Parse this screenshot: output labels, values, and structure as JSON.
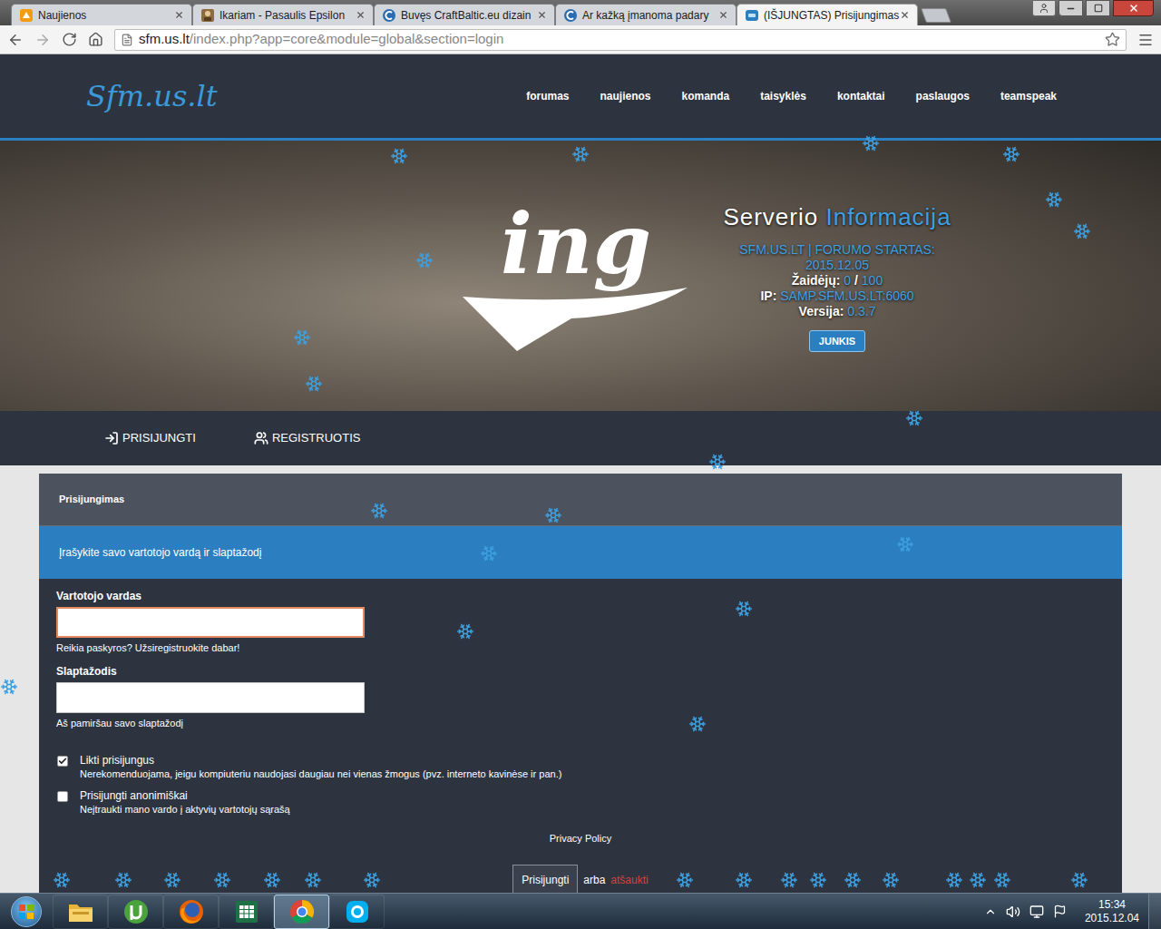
{
  "browser": {
    "tabs": [
      {
        "label": "Naujienos",
        "selected": false,
        "kind": "orange"
      },
      {
        "label": "Ikariam - Pasaulis Epsilon",
        "selected": false,
        "kind": "ikariam"
      },
      {
        "label": "Buvęs CraftBaltic.eu dizain",
        "selected": false,
        "kind": "craftbaltic"
      },
      {
        "label": "Ar kažką įmanoma padary",
        "selected": false,
        "kind": "craftbaltic"
      },
      {
        "label": "(IŠJUNGTAS) Prisijungimas",
        "selected": true,
        "kind": "sfm"
      }
    ],
    "url_host": "sfm.us.lt",
    "url_path": "/index.php?app=core&module=global&section=login"
  },
  "site": {
    "logo": "Sfm.us.lt",
    "nav": [
      "forumas",
      "naujienos",
      "komanda",
      "taisyklės",
      "kontaktai",
      "paslaugos",
      "teamspeak"
    ]
  },
  "banner": {
    "logo": "ing",
    "title_a": "Serverio",
    "title_b": "Informacija",
    "start_label": "SFM.US.LT | FORUMO STARTAS:",
    "start_date": "2015.12.05",
    "players_label": "Žaidėjų:",
    "players": "0",
    "players_sep": "/",
    "players_max": "100",
    "ip_label": "IP:",
    "ip": "SAMP.SFM.US.LT:6060",
    "version_label": "Versija:",
    "version": "0.3.7",
    "join": "JUNKIS"
  },
  "subnav": [
    {
      "label": "PRISIJUNGTI",
      "kind": "login"
    },
    {
      "label": "REGISTRUOTIS",
      "kind": "register"
    }
  ],
  "login": {
    "title": "Prisijungimas",
    "instruction": "Įrašykite savo vartotojo vardą ir slaptažodį",
    "fields": [
      {
        "label": "Vartotojo vardas",
        "value": "",
        "focused": true,
        "help": "Reikia paskyros? Užsiregistruokite dabar!"
      },
      {
        "label": "Slaptažodis",
        "value": "",
        "focused": false,
        "help": "Aš pamiršau savo slaptažodį"
      }
    ],
    "options": [
      {
        "label": "Likti prisijungus",
        "description": "Nerekomenduojama, jeigu kompiuteriu naudojasi daugiau nei vienas žmogus (pvz. interneto kavinėse ir pan.)",
        "checked": true
      },
      {
        "label": "Prisijungti anonimiškai",
        "description": "Neįtraukti mano vardo į aktyvių vartotojų sąrašą",
        "checked": false
      }
    ],
    "privacy": "Privacy Policy",
    "submit": "Prisijungti",
    "or": "arba",
    "cancel": "atšaukti"
  },
  "taskbar": {
    "apps": [
      {
        "kind": "explorer",
        "selected": false
      },
      {
        "kind": "utorrent",
        "selected": false
      },
      {
        "kind": "firefox",
        "selected": false
      },
      {
        "kind": "excel",
        "selected": false
      },
      {
        "kind": "chrome",
        "selected": true
      },
      {
        "kind": "skype",
        "selected": false
      }
    ],
    "time": "15:34",
    "date": "2015.12.04"
  }
}
